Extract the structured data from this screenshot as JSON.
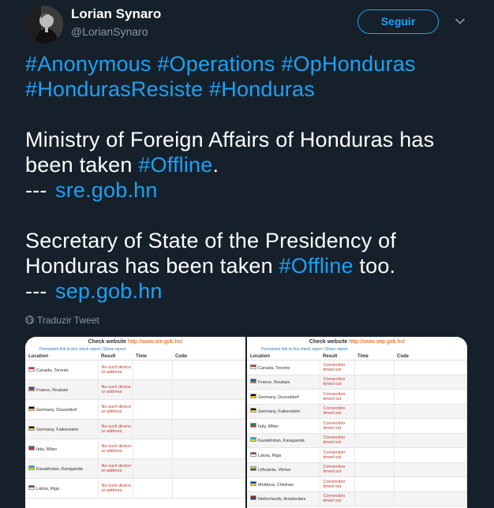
{
  "author": {
    "name": "Lorian Synaro",
    "handle": "@LorianSynaro",
    "follow_label": "Seguir"
  },
  "tweet": {
    "hashtags_line1": [
      "#Anonymous",
      "#Operations",
      "#OpHonduras"
    ],
    "hashtags_line2": [
      "#HondurasResiste",
      "#Honduras"
    ],
    "p1_line1": "Ministry of Foreign Affairs of Honduras has",
    "p1_line2_a": "been taken ",
    "p1_hashtag": "#Offline",
    "p1_line2_b": ".",
    "dash": "---",
    "link1": "sre.gob.hn",
    "p2_line1": "Secretary of State of the Presidency of",
    "p2_line2_a": "Honduras has been taken ",
    "p2_hashtag": "#Offline",
    "p2_line2_b": " too.",
    "link2": "sep.gob.hn",
    "translate_label": "Traduzir Tweet"
  },
  "media": {
    "panels": [
      {
        "title": "Check website",
        "url": "http://www.sre.gob.hn/",
        "permalink": "Permanent link to this check report  |  Share report:",
        "columns": [
          "Location",
          "Result",
          "Time",
          "Code"
        ],
        "rows": [
          {
            "location": "Canada, Toronto",
            "result": "No such device or address",
            "flag": [
              "#d52b1e",
              "#ffffff"
            ]
          },
          {
            "location": "France, Roubaix",
            "result": "No such device or address",
            "flag": [
              "#0055a4",
              "#ef4135"
            ]
          },
          {
            "location": "Germany, Dusseldorf",
            "result": "No such device or address",
            "flag": [
              "#000000",
              "#ffce00"
            ]
          },
          {
            "location": "Germany, Falkenstein",
            "result": "No such device or address",
            "flag": [
              "#000000",
              "#ffce00"
            ]
          },
          {
            "location": "Italy, Milan",
            "result": "No such device or address",
            "flag": [
              "#009246",
              "#ce2b37"
            ]
          },
          {
            "location": "Kazakhstan, Karaganda",
            "result": "No such device or address",
            "flag": [
              "#00afca",
              "#fec50c"
            ]
          },
          {
            "location": "Latvia, Riga",
            "result": "No such device or address",
            "flag": [
              "#9e3039",
              "#ffffff"
            ]
          }
        ]
      },
      {
        "title": "Check website",
        "url": "http://www.sep.gob.hn/",
        "permalink": "Permanent link to this check report  |  Share report:",
        "columns": [
          "Location",
          "Result",
          "Time",
          "Code"
        ],
        "rows": [
          {
            "location": "Canada, Toronto",
            "result": "Connection timed out",
            "flag": [
              "#d52b1e",
              "#ffffff"
            ]
          },
          {
            "location": "France, Roubaix",
            "result": "Connection timed out",
            "flag": [
              "#0055a4",
              "#ef4135"
            ]
          },
          {
            "location": "Germany, Dusseldorf",
            "result": "Connection timed out",
            "flag": [
              "#000000",
              "#ffce00"
            ]
          },
          {
            "location": "Germany, Falkenstein",
            "result": "Connection timed out",
            "flag": [
              "#000000",
              "#ffce00"
            ]
          },
          {
            "location": "Italy, Milan",
            "result": "Connection timed out",
            "flag": [
              "#009246",
              "#ce2b37"
            ]
          },
          {
            "location": "Kazakhstan, Karaganda",
            "result": "Connection timed out",
            "flag": [
              "#00afca",
              "#fec50c"
            ]
          },
          {
            "location": "Latvia, Riga",
            "result": "Connection timed out",
            "flag": [
              "#9e3039",
              "#ffffff"
            ]
          },
          {
            "location": "Lithuania, Vilnius",
            "result": "Connection timed out",
            "flag": [
              "#fdb913",
              "#006a44"
            ]
          },
          {
            "location": "Moldova, Chisinau",
            "result": "Connection timed out",
            "flag": [
              "#0046ae",
              "#ffd200"
            ]
          },
          {
            "location": "Netherlands, Amsterdam",
            "result": "Connection timed out",
            "flag": [
              "#ae1c28",
              "#21468b"
            ]
          }
        ]
      }
    ]
  },
  "colors": {
    "background": "#15202b",
    "accent": "#1da1f2",
    "muted": "#8899a6"
  },
  "icons": {
    "follow_menu": "chevron-down-icon",
    "translate": "globe-icon"
  }
}
